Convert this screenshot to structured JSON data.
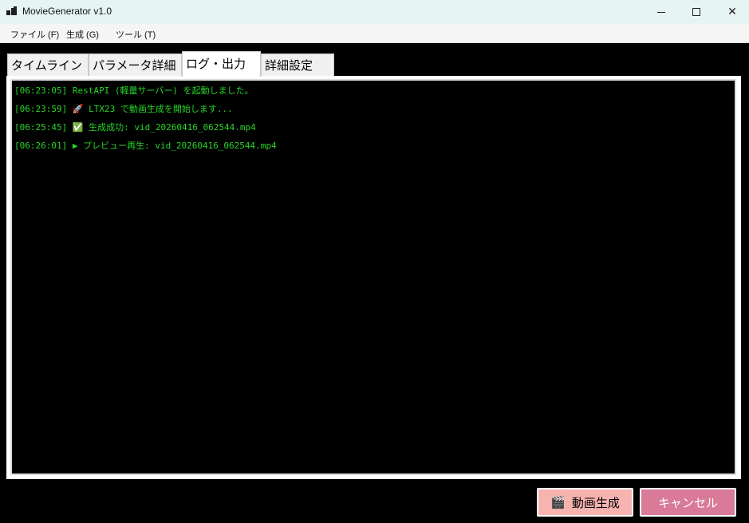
{
  "window": {
    "title": "MovieGenerator v1.0",
    "controls": {
      "minimize": "",
      "maximize": "",
      "close": "✕"
    }
  },
  "menu": {
    "file": "ファイル (F)",
    "generate": "生成 (G)",
    "tools": "ツール (T)"
  },
  "tabs": {
    "timeline": "タイムライン",
    "params": "パラメータ詳細",
    "log": "ログ・出力",
    "details": "詳細設定",
    "active": "log"
  },
  "log": {
    "lines": [
      "[06:23:05] RestAPI (軽量サーバー) を起動しました。",
      "[06:23:59] 🚀 LTX23 で動画生成を開始します...",
      "[06:25:45] ✅ 生成成功: vid_20260416_062544.mp4",
      "[06:26:01] ▶ プレビュー再生: vid_20260416_062544.mp4"
    ],
    "text_color": "#27d627",
    "background": "#000000"
  },
  "buttons": {
    "generate": {
      "icon": "🎬",
      "label": "動画生成",
      "color": "#f7b3b0"
    },
    "cancel": {
      "label": "キャンセル",
      "color": "#d87a98"
    }
  }
}
